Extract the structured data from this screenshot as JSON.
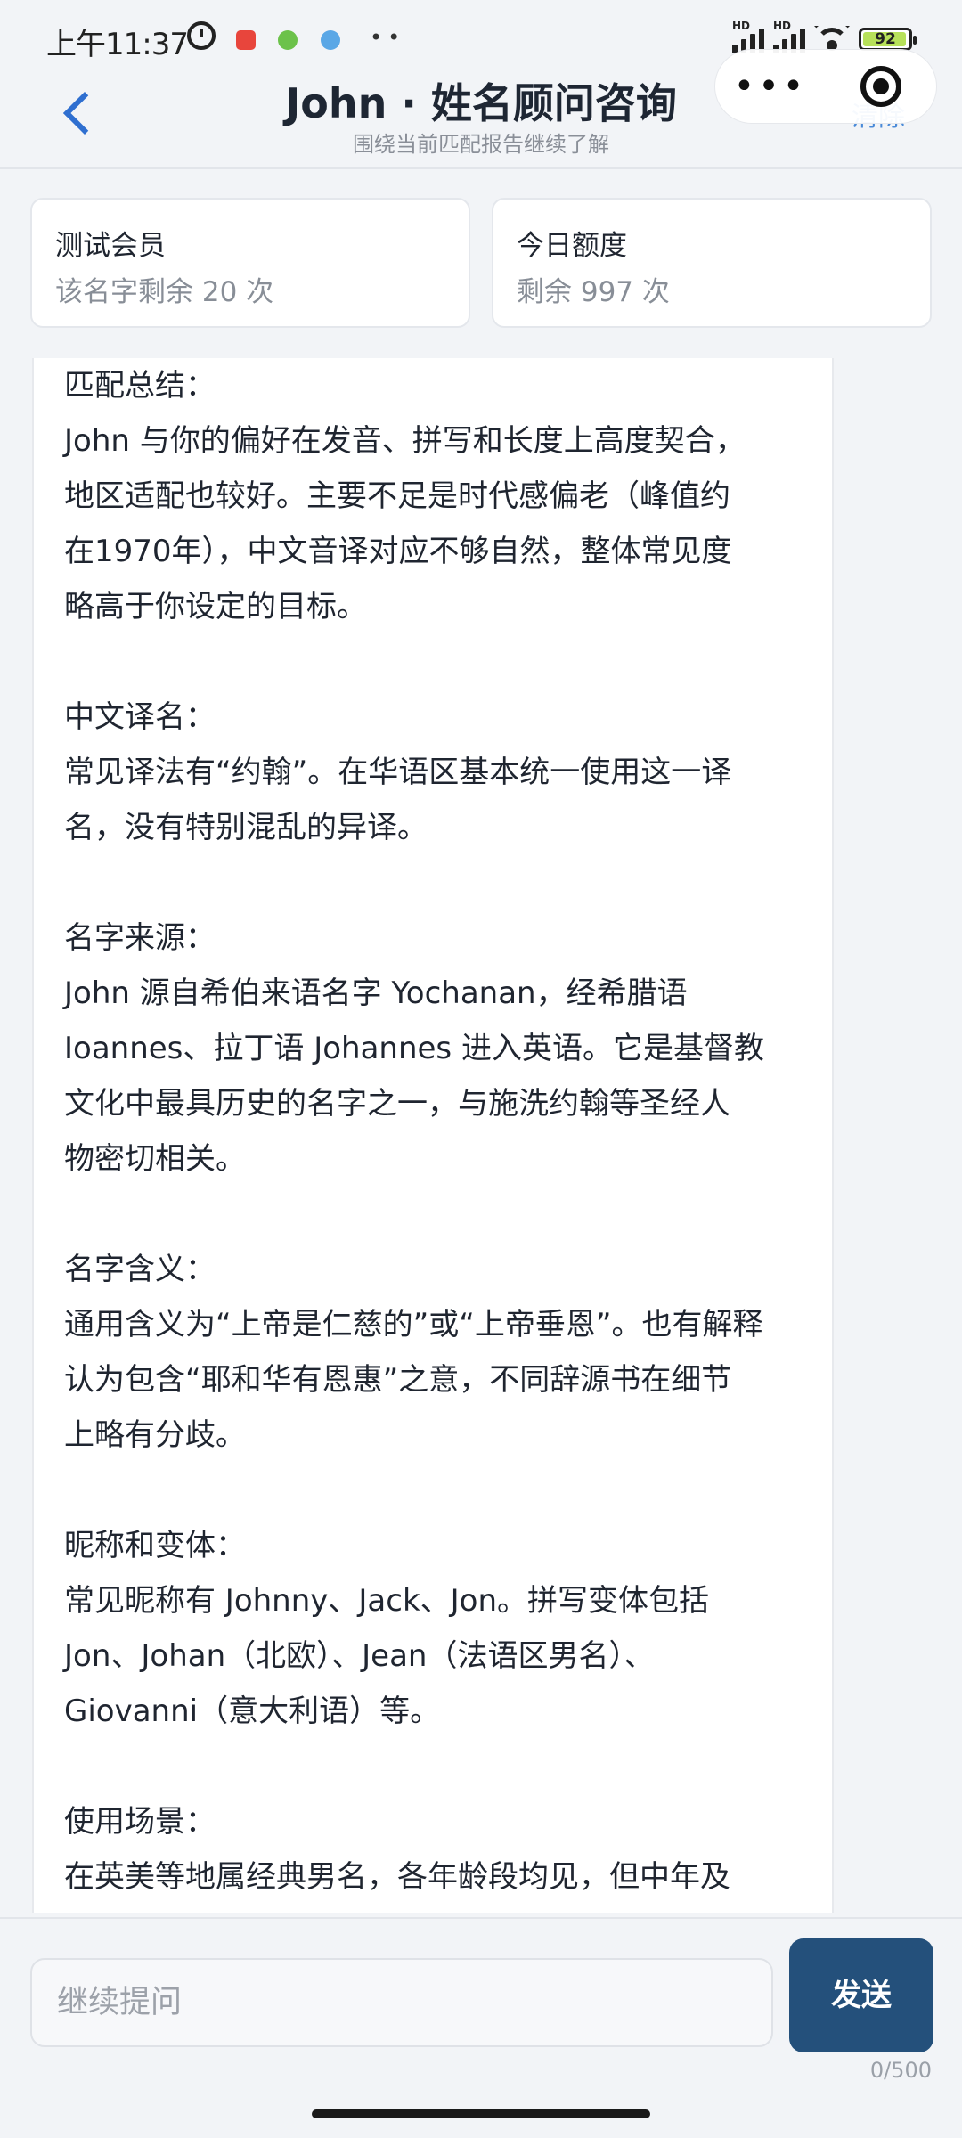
{
  "status_bar": {
    "time": "上午11:37",
    "battery": "92",
    "signal_label": "HD"
  },
  "header": {
    "title": "John · 姓名顾问咨询",
    "subtitle": "围绕当前匹配报告继续了解",
    "clear_label": "清除"
  },
  "cards": [
    {
      "title": "测试会员",
      "value": "该名字剩余 20 次"
    },
    {
      "title": "今日额度",
      "value": "剩余 997 次"
    }
  ],
  "message": {
    "sections": [
      {
        "heading": "匹配总结：",
        "lines": [
          "John 与你的偏好在发音、拼写和长度上高度契合，",
          "地区适配也较好。主要不足是时代感偏老（峰值约",
          "在1970年），中文音译对应不够自然，整体常见度",
          "略高于你设定的目标。"
        ]
      },
      {
        "heading": "中文译名：",
        "lines": [
          "常见译法有“约翰”。在华语区基本统一使用这一译",
          "名，没有特别混乱的异译。"
        ]
      },
      {
        "heading": "名字来源：",
        "lines": [
          "John 源自希伯来语名字 Yochanan，经希腊语",
          "Ioannes、拉丁语 Johannes 进入英语。它是基督教",
          "文化中最具历史的名字之一，与施洗约翰等圣经人",
          "物密切相关。"
        ]
      },
      {
        "heading": "名字含义：",
        "lines": [
          "通用含义为“上帝是仁慈的”或“上帝垂恩”。也有解释",
          "认为包含“耶和华有恩惠”之意，不同辞源书在细节",
          "上略有分歧。"
        ]
      },
      {
        "heading": "昵称和变体：",
        "lines": [
          "常见昵称有 Johnny、Jack、Jon。拼写变体包括",
          "Jon、Johan（北欧）、Jean（法语区男名）、",
          "Giovanni（意大利语）等。"
        ]
      },
      {
        "heading": "使用场景：",
        "lines": [
          "在英美等地属经典男名，各年龄段均见，但中年及"
        ]
      }
    ]
  },
  "composer": {
    "placeholder": "继续提问",
    "send_label": "发送",
    "counter": "0/500"
  },
  "colors": {
    "accent": "#2f6fd0",
    "send_button": "#24507b",
    "background": "#f2f4f7"
  }
}
